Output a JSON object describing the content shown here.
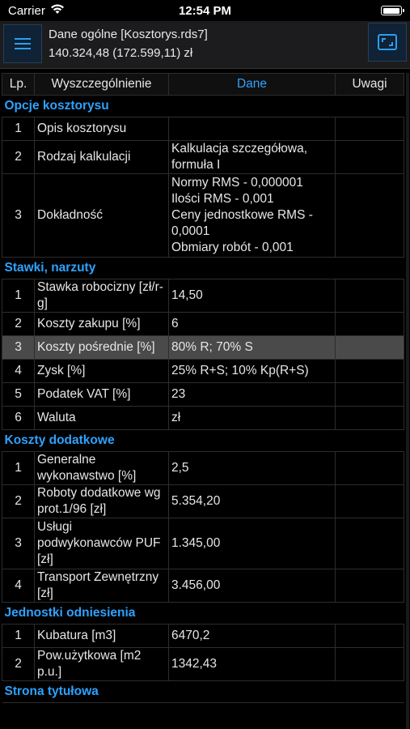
{
  "status_bar": {
    "carrier": "Carrier",
    "time": "12:54 PM"
  },
  "header": {
    "title": "Dane ogólne [Kosztorys.rds7]",
    "subtitle": "140.324,48 (172.599,11) zł"
  },
  "table": {
    "columns": [
      "Lp.",
      "Wyszczególnienie",
      "Dane",
      "Uwagi"
    ],
    "sections": [
      {
        "title": "Opcje kosztorysu",
        "rows": [
          {
            "lp": "1",
            "name": "Opis kosztorysu",
            "value": "",
            "note": ""
          },
          {
            "lp": "2",
            "name": "Rodzaj kalkulacji",
            "value": "Kalkulacja szczegółowa, formuła I",
            "note": ""
          },
          {
            "lp": "3",
            "name": "Dokładność",
            "value": "Normy RMS - 0,000001\nIlości RMS - 0,001\nCeny jednostkowe RMS - 0,0001\nObmiary robót - 0,001",
            "note": ""
          }
        ]
      },
      {
        "title": "Stawki, narzuty",
        "rows": [
          {
            "lp": "1",
            "name": "Stawka robocizny [zł/r-g]",
            "value": "14,50",
            "note": ""
          },
          {
            "lp": "2",
            "name": "Koszty zakupu [%]",
            "value": "6",
            "note": ""
          },
          {
            "lp": "3",
            "name": "Koszty pośrednie [%]",
            "value": "80% R; 70% S",
            "note": "",
            "selected": true
          },
          {
            "lp": "4",
            "name": "Zysk [%]",
            "value": "25% R+S; 10% Kp(R+S)",
            "note": ""
          },
          {
            "lp": "5",
            "name": "Podatek VAT [%]",
            "value": "23",
            "note": ""
          },
          {
            "lp": "6",
            "name": "Waluta",
            "value": "zł",
            "note": ""
          }
        ]
      },
      {
        "title": "Koszty dodatkowe",
        "rows": [
          {
            "lp": "1",
            "name": "Generalne wykonawstwo [%]",
            "value": "2,5",
            "note": ""
          },
          {
            "lp": "2",
            "name": "Roboty dodatkowe wg prot.1/96 [zł]",
            "value": "5.354,20",
            "note": ""
          },
          {
            "lp": "3",
            "name": "Usługi podwykonawców PUF [zł]",
            "value": "1.345,00",
            "note": ""
          },
          {
            "lp": "4",
            "name": "Transport Zewnętrzny [zł]",
            "value": "3.456,00",
            "note": ""
          }
        ]
      },
      {
        "title": "Jednostki odniesienia",
        "rows": [
          {
            "lp": "1",
            "name": "Kubatura [m3]",
            "value": "6470,2",
            "note": ""
          },
          {
            "lp": "2",
            "name": "Pow.użytkowa [m2 p.u.]",
            "value": "1342,43",
            "note": ""
          }
        ]
      },
      {
        "title": "Strona tytułowa",
        "rows": []
      }
    ]
  },
  "icons": {
    "menu": "hamburger-menu-icon",
    "expand": "expand-frame-icon",
    "wifi": "wifi-icon",
    "battery": "battery-icon"
  },
  "colors": {
    "accent": "#2ea2ff",
    "selected_row": "#4a4a4a",
    "toolbar": "#1c1c1e",
    "background": "#000000"
  }
}
